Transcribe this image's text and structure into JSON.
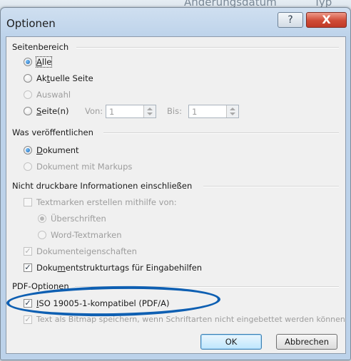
{
  "background": {
    "left_text": "Änderungsdatum",
    "right_text": "Typ"
  },
  "dialog": {
    "title": "Optionen",
    "help_label": "?",
    "close_label": "X"
  },
  "seitenbereich": {
    "header": "Seitenbereich",
    "alle": {
      "pre": "",
      "acc": "A",
      "post": "lle",
      "selected": true
    },
    "aktuelle": {
      "pre": "Ak",
      "acc": "t",
      "post": "uelle Seite",
      "selected": false
    },
    "auswahl": {
      "label": "Auswahl",
      "enabled": false
    },
    "seiten": {
      "pre": "",
      "acc": "S",
      "post": "eite(n)",
      "selected": false
    },
    "von_label": "Von:",
    "von_value": "1",
    "bis_label": "Bis:",
    "bis_value": "1"
  },
  "was": {
    "header": "Was veröffentlichen",
    "dokument": {
      "pre": "",
      "acc": "D",
      "post": "okument",
      "selected": true
    },
    "markups": {
      "label": "Dokument mit Markups",
      "enabled": false
    }
  },
  "nicht": {
    "header": "Nicht druckbare Informationen einschließen",
    "textmarken": {
      "label": "Textmarken erstellen mithilfe von:",
      "checked": false,
      "enabled": false
    },
    "ueberschriften": {
      "label": "Überschriften",
      "selected": true,
      "enabled": false
    },
    "word": {
      "label": "Word-Textmarken",
      "selected": false,
      "enabled": false
    },
    "eigenschaften": {
      "label": "Dokumenteigenschaften",
      "checked": true,
      "enabled": false
    },
    "struktur": {
      "pre": "Doku",
      "acc": "m",
      "post": "entstrukturtags für Eingabehilfen",
      "checked": true
    }
  },
  "pdf": {
    "header": "PDF-Optionen",
    "iso": {
      "pre": "",
      "acc": "I",
      "post": "SO 19005-1-kompatibel (PDF/A)",
      "checked": true
    },
    "bitmap": {
      "label": "Text als Bitmap speichern, wenn Schriftarten nicht eingebettet werden können",
      "checked": true,
      "enabled": false
    }
  },
  "buttons": {
    "ok": "OK",
    "cancel": "Abbrechen"
  },
  "colors": {
    "annotation_ellipse": "#0e5fb2",
    "close_button": "#c9442f"
  }
}
